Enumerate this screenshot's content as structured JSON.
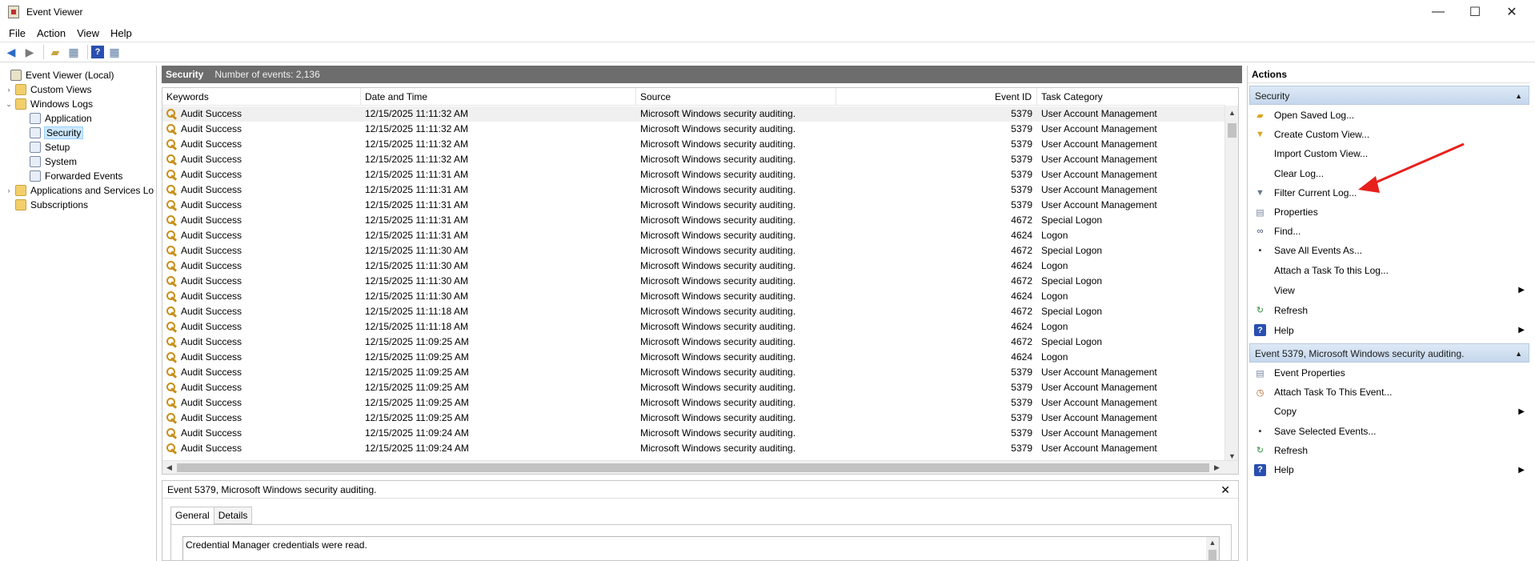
{
  "window": {
    "title": "Event Viewer",
    "controls": [
      "—",
      "☐",
      "✕"
    ]
  },
  "menu": [
    "File",
    "Action",
    "View",
    "Help"
  ],
  "tree": [
    {
      "label": "Event Viewer (Local)",
      "level": 0,
      "expander": "",
      "icon": "root",
      "name": "tree-event-viewer-local"
    },
    {
      "label": "Custom Views",
      "level": 1,
      "expander": "›",
      "icon": "folder",
      "name": "tree-custom-views"
    },
    {
      "label": "Windows Logs",
      "level": 1,
      "expander": "⌄",
      "icon": "folder",
      "name": "tree-windows-logs"
    },
    {
      "label": "Application",
      "level": 2,
      "expander": "",
      "icon": "log",
      "name": "tree-application"
    },
    {
      "label": "Security",
      "level": 2,
      "expander": "",
      "icon": "log",
      "name": "tree-security",
      "selected": true
    },
    {
      "label": "Setup",
      "level": 2,
      "expander": "",
      "icon": "log",
      "name": "tree-setup"
    },
    {
      "label": "System",
      "level": 2,
      "expander": "",
      "icon": "log",
      "name": "tree-system"
    },
    {
      "label": "Forwarded Events",
      "level": 2,
      "expander": "",
      "icon": "log",
      "name": "tree-forwarded-events"
    },
    {
      "label": "Applications and Services Lo",
      "level": 1,
      "expander": "›",
      "icon": "folder",
      "name": "tree-applications-services"
    },
    {
      "label": "Subscriptions",
      "level": 1,
      "expander": "",
      "icon": "folder",
      "name": "tree-subscriptions"
    }
  ],
  "log": {
    "name": "Security",
    "count_text": "Number of events: 2,136"
  },
  "columns": [
    "Keywords",
    "Date and Time",
    "Source",
    "Event ID",
    "Task Category"
  ],
  "events": [
    [
      "Audit Success",
      "12/15/2025 11:11:32 AM",
      "Microsoft Windows security auditing.",
      "5379",
      "User Account Management"
    ],
    [
      "Audit Success",
      "12/15/2025 11:11:32 AM",
      "Microsoft Windows security auditing.",
      "5379",
      "User Account Management"
    ],
    [
      "Audit Success",
      "12/15/2025 11:11:32 AM",
      "Microsoft Windows security auditing.",
      "5379",
      "User Account Management"
    ],
    [
      "Audit Success",
      "12/15/2025 11:11:32 AM",
      "Microsoft Windows security auditing.",
      "5379",
      "User Account Management"
    ],
    [
      "Audit Success",
      "12/15/2025 11:11:31 AM",
      "Microsoft Windows security auditing.",
      "5379",
      "User Account Management"
    ],
    [
      "Audit Success",
      "12/15/2025 11:11:31 AM",
      "Microsoft Windows security auditing.",
      "5379",
      "User Account Management"
    ],
    [
      "Audit Success",
      "12/15/2025 11:11:31 AM",
      "Microsoft Windows security auditing.",
      "5379",
      "User Account Management"
    ],
    [
      "Audit Success",
      "12/15/2025 11:11:31 AM",
      "Microsoft Windows security auditing.",
      "4672",
      "Special Logon"
    ],
    [
      "Audit Success",
      "12/15/2025 11:11:31 AM",
      "Microsoft Windows security auditing.",
      "4624",
      "Logon"
    ],
    [
      "Audit Success",
      "12/15/2025 11:11:30 AM",
      "Microsoft Windows security auditing.",
      "4672",
      "Special Logon"
    ],
    [
      "Audit Success",
      "12/15/2025 11:11:30 AM",
      "Microsoft Windows security auditing.",
      "4624",
      "Logon"
    ],
    [
      "Audit Success",
      "12/15/2025 11:11:30 AM",
      "Microsoft Windows security auditing.",
      "4672",
      "Special Logon"
    ],
    [
      "Audit Success",
      "12/15/2025 11:11:30 AM",
      "Microsoft Windows security auditing.",
      "4624",
      "Logon"
    ],
    [
      "Audit Success",
      "12/15/2025 11:11:18 AM",
      "Microsoft Windows security auditing.",
      "4672",
      "Special Logon"
    ],
    [
      "Audit Success",
      "12/15/2025 11:11:18 AM",
      "Microsoft Windows security auditing.",
      "4624",
      "Logon"
    ],
    [
      "Audit Success",
      "12/15/2025 11:09:25 AM",
      "Microsoft Windows security auditing.",
      "4672",
      "Special Logon"
    ],
    [
      "Audit Success",
      "12/15/2025 11:09:25 AM",
      "Microsoft Windows security auditing.",
      "4624",
      "Logon"
    ],
    [
      "Audit Success",
      "12/15/2025 11:09:25 AM",
      "Microsoft Windows security auditing.",
      "5379",
      "User Account Management"
    ],
    [
      "Audit Success",
      "12/15/2025 11:09:25 AM",
      "Microsoft Windows security auditing.",
      "5379",
      "User Account Management"
    ],
    [
      "Audit Success",
      "12/15/2025 11:09:25 AM",
      "Microsoft Windows security auditing.",
      "5379",
      "User Account Management"
    ],
    [
      "Audit Success",
      "12/15/2025 11:09:25 AM",
      "Microsoft Windows security auditing.",
      "5379",
      "User Account Management"
    ],
    [
      "Audit Success",
      "12/15/2025 11:09:24 AM",
      "Microsoft Windows security auditing.",
      "5379",
      "User Account Management"
    ],
    [
      "Audit Success",
      "12/15/2025 11:09:24 AM",
      "Microsoft Windows security auditing.",
      "5379",
      "User Account Management"
    ]
  ],
  "detail": {
    "title": "Event 5379, Microsoft Windows security auditing.",
    "tabs": [
      "General",
      "Details"
    ],
    "description": "Credential Manager credentials were read."
  },
  "actions": {
    "title": "Actions",
    "section1": {
      "title": "Security",
      "items": [
        {
          "label": "Open Saved Log...",
          "icon": "open-log-icon",
          "glyph": "▰",
          "color": "#d9a520",
          "submenu": false
        },
        {
          "label": "Create Custom View...",
          "icon": "filter-icon",
          "glyph": "▼",
          "color": "#d9a520",
          "submenu": false
        },
        {
          "label": "Import Custom View...",
          "icon": "",
          "glyph": "",
          "color": "",
          "submenu": false
        },
        {
          "label": "Clear Log...",
          "icon": "",
          "glyph": "",
          "color": "",
          "submenu": false
        },
        {
          "label": "Filter Current Log...",
          "icon": "filter-icon",
          "glyph": "▼",
          "color": "#6a7a8a",
          "submenu": false
        },
        {
          "label": "Properties",
          "icon": "properties-icon",
          "glyph": "▤",
          "color": "#7a8aa0",
          "submenu": false
        },
        {
          "label": "Find...",
          "icon": "binoculars-icon",
          "glyph": "∞",
          "color": "#3a4a6a",
          "submenu": false
        },
        {
          "label": "Save All Events As...",
          "icon": "save-icon",
          "glyph": "▪",
          "color": "#3a3a3a",
          "submenu": false
        },
        {
          "label": "Attach a Task To this Log...",
          "icon": "",
          "glyph": "",
          "color": "",
          "submenu": false
        },
        {
          "label": "View",
          "icon": "",
          "glyph": "",
          "color": "",
          "submenu": true
        },
        {
          "label": "Refresh",
          "icon": "refresh-icon",
          "glyph": "↻",
          "color": "#2f8f3a",
          "submenu": false
        },
        {
          "label": "Help",
          "icon": "help-icon",
          "glyph": "?",
          "color": "#2a4fb0",
          "submenu": true
        }
      ]
    },
    "section2": {
      "title": "Event 5379, Microsoft Windows security auditing.",
      "items": [
        {
          "label": "Event Properties",
          "icon": "properties-icon",
          "glyph": "▤",
          "color": "#7a8aa0",
          "submenu": false
        },
        {
          "label": "Attach Task To This Event...",
          "icon": "task-icon",
          "glyph": "◷",
          "color": "#b0602a",
          "submenu": false
        },
        {
          "label": "Copy",
          "icon": "",
          "glyph": "",
          "color": "",
          "submenu": true
        },
        {
          "label": "Save Selected Events...",
          "icon": "save-icon",
          "glyph": "▪",
          "color": "#3a3a3a",
          "submenu": false
        },
        {
          "label": "Refresh",
          "icon": "refresh-icon",
          "glyph": "↻",
          "color": "#2f8f3a",
          "submenu": false
        },
        {
          "label": "Help",
          "icon": "help-icon",
          "glyph": "?",
          "color": "#2a4fb0",
          "submenu": true
        }
      ]
    }
  },
  "annotation": {
    "color": "#e8201c"
  }
}
